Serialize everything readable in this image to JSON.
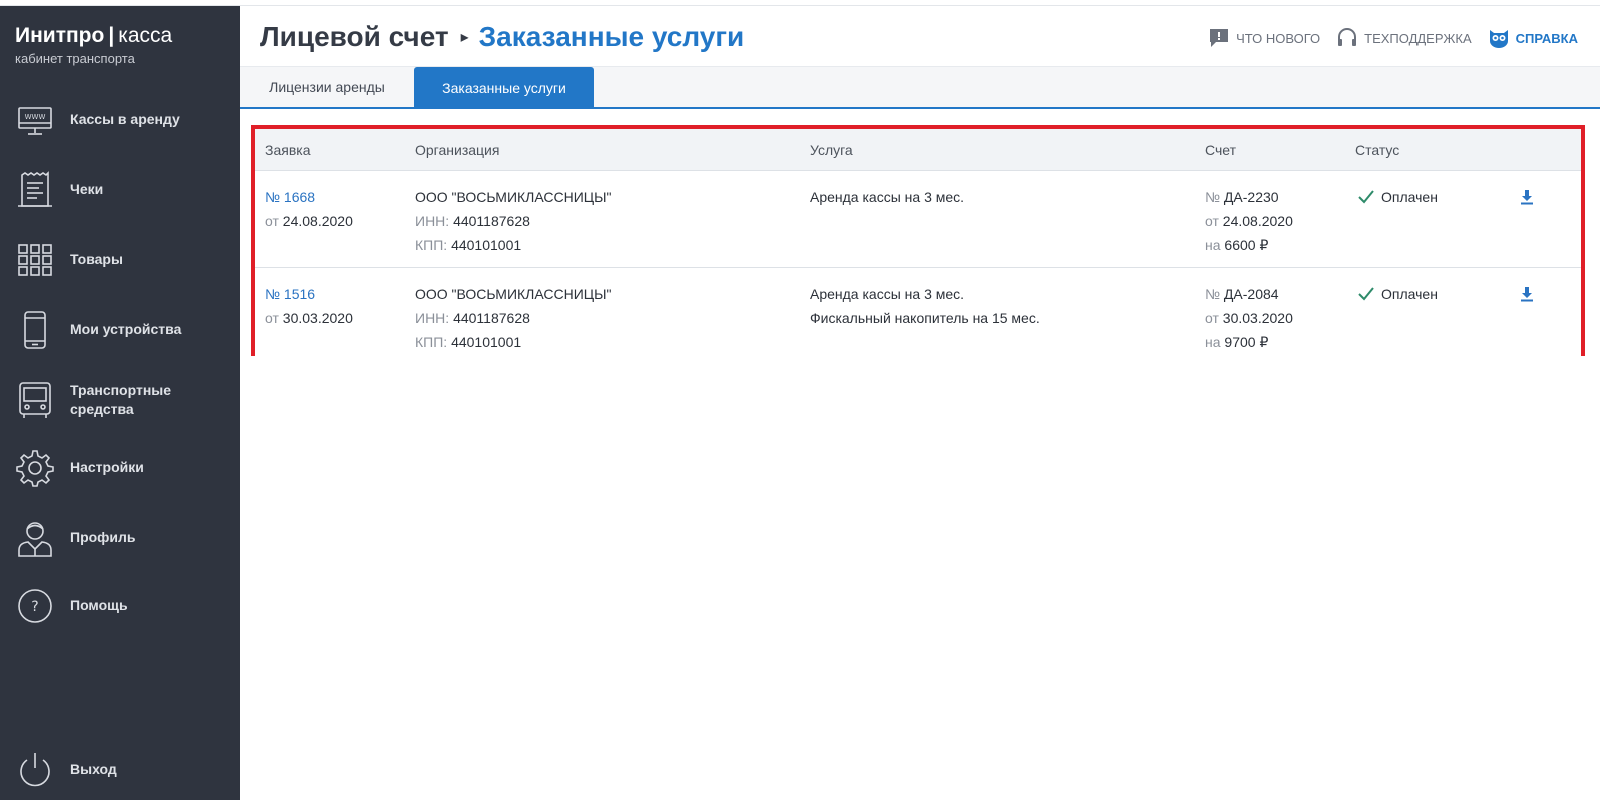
{
  "brand": {
    "name": "Инитпро",
    "separator": "|",
    "product": "касса",
    "subtitle": "кабинет транспорта"
  },
  "sidebar": {
    "items": [
      {
        "label": "Кассы в аренду",
        "icon": "monitor-www-icon"
      },
      {
        "label": "Чеки",
        "icon": "receipt-icon"
      },
      {
        "label": "Товары",
        "icon": "grid-icon"
      },
      {
        "label": "Мои устройства",
        "icon": "phone-icon"
      },
      {
        "label": "Транспортные средства",
        "icon": "bus-icon"
      },
      {
        "label": "Настройки",
        "icon": "gear-icon"
      },
      {
        "label": "Профиль",
        "icon": "user-icon"
      },
      {
        "label": "Помощь",
        "icon": "help-circle-icon"
      }
    ],
    "logout": {
      "label": "Выход",
      "icon": "power-icon"
    }
  },
  "header": {
    "breadcrumb_root": "Лицевой счет",
    "breadcrumb_current": "Заказанные услуги",
    "links": {
      "news": "ЧТО НОВОГО",
      "support": "ТЕХПОДДЕРЖКА",
      "help": "СПРАВКА"
    }
  },
  "tabs": [
    {
      "label": "Лицензии аренды",
      "active": false
    },
    {
      "label": "Заказанные услуги",
      "active": true
    }
  ],
  "table": {
    "columns": [
      "Заявка",
      "Организация",
      "Услуга",
      "Счет",
      "Статус"
    ],
    "labels": {
      "num": "№",
      "from": "от",
      "inn": "ИНН:",
      "kpp": "КПП:",
      "amount": "на"
    },
    "rows": [
      {
        "order_no": "1668",
        "order_date": "24.08.2020",
        "org_name": "ООО \"ВОСЬМИКЛАССНИЦЫ\"",
        "inn": "4401187628",
        "kpp": "440101001",
        "services": [
          "Аренда кассы на 3 мес."
        ],
        "invoice_no": "ДА-2230",
        "invoice_date": "24.08.2020",
        "invoice_amount": "6600 ₽",
        "status": "Оплачен"
      },
      {
        "order_no": "1516",
        "order_date": "30.03.2020",
        "org_name": "ООО \"ВОСЬМИКЛАССНИЦЫ\"",
        "inn": "4401187628",
        "kpp": "440101001",
        "services": [
          "Аренда кассы на 3 мес.",
          "Фискальный накопитель на 15 мес."
        ],
        "invoice_no": "ДА-2084",
        "invoice_date": "30.03.2020",
        "invoice_amount": "9700 ₽",
        "status": "Оплачен"
      }
    ]
  },
  "colors": {
    "sidebar_bg": "#2f343f",
    "accent": "#2277c7",
    "highlight_border": "#e01f28",
    "status_ok": "#2e8b6a"
  }
}
